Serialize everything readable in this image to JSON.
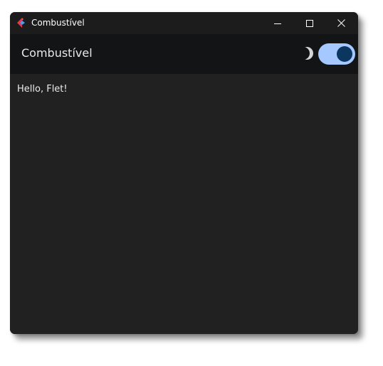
{
  "window": {
    "title": "Combustível",
    "controls": {
      "minimize_icon": "minimize-icon",
      "maximize_icon": "maximize-icon",
      "close_icon": "close-icon"
    }
  },
  "appbar": {
    "title": "Combustível",
    "theme_icon": "moon-icon",
    "theme_toggle_on": true
  },
  "main": {
    "text": "Hello, Flet!"
  },
  "colors": {
    "window_bg": "#212121",
    "titlebar_bg": "#1c1c1c",
    "appbar_bg": "#121416",
    "toggle_track": "#a4c8ff",
    "toggle_thumb": "#0b3660",
    "icon_red": "#e8384d",
    "icon_blue": "#4a9ff5"
  }
}
